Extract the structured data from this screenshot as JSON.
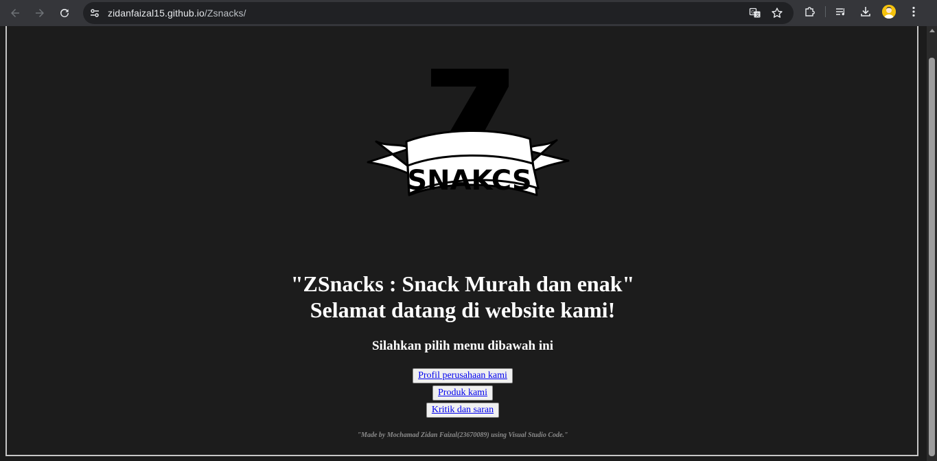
{
  "browser": {
    "url_host": "zidanfaizal15.github.io",
    "url_path": "/Zsnacks/",
    "icons": {
      "back": "back-arrow-icon",
      "forward": "forward-arrow-icon",
      "reload": "reload-icon",
      "site_info": "tune-icon",
      "translate": "translate-icon",
      "bookmark": "star-icon",
      "extensions": "puzzle-icon",
      "media": "playlist-icon",
      "downloads": "download-icon",
      "menu": "more-vert-icon"
    }
  },
  "page": {
    "logo": {
      "letter": "Z",
      "banner_text": "SNAKCS"
    },
    "headline_line1": "\"ZSnacks : Snack Murah dan enak\"",
    "headline_line2": "Selamat datang di website kami!",
    "subheading": "Silahkan pilih menu dibawah ini",
    "menu": [
      {
        "label": "Profil perusahaan kami"
      },
      {
        "label": "Produk kami"
      },
      {
        "label": "Kritik dan saran"
      }
    ],
    "footer": "\"Made by Mochamad Zidan Faizal(23670089) using Visual Studio Code.\""
  },
  "colors": {
    "page_background": "#1c1c1c",
    "text": "#ffffff",
    "link": "#0000ee",
    "footer": "#8a8a8a"
  }
}
